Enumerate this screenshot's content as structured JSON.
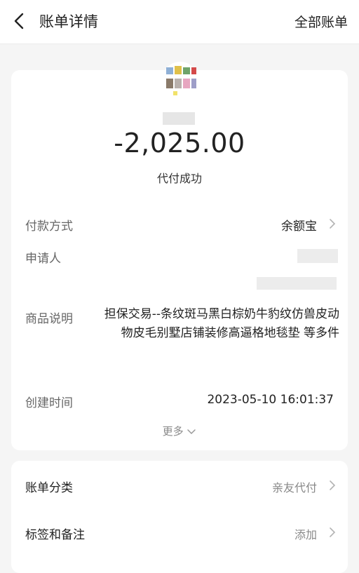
{
  "header": {
    "title": "账单详情",
    "right_link": "全部账单"
  },
  "summary": {
    "amount": "-2,025.00",
    "status": "代付成功"
  },
  "details": {
    "payment_method_label": "付款方式",
    "payment_method_value": "余额宝",
    "applicant_label": "申请人",
    "product_label": "商品说明",
    "product_value": "担保交易--条纹斑马黑白棕奶牛豹纹仿兽皮动物皮毛别墅店铺装修高逼格地毯垫 等多件",
    "created_label": "创建时间",
    "created_value": "2023-05-10 16:01:37",
    "more_label": "更多"
  },
  "extras": {
    "category_label": "账单分类",
    "category_value": "亲友代付",
    "tags_label": "标签和备注",
    "tags_value": "添加"
  },
  "icons": {
    "back": "back-arrow-icon",
    "chevron_right": "chevron-right-icon",
    "chevron_down": "chevron-down-icon"
  },
  "colors": {
    "background": "#f5f5f5",
    "card": "#ffffff",
    "label": "#666666",
    "value": "#222222",
    "muted": "#888888"
  }
}
